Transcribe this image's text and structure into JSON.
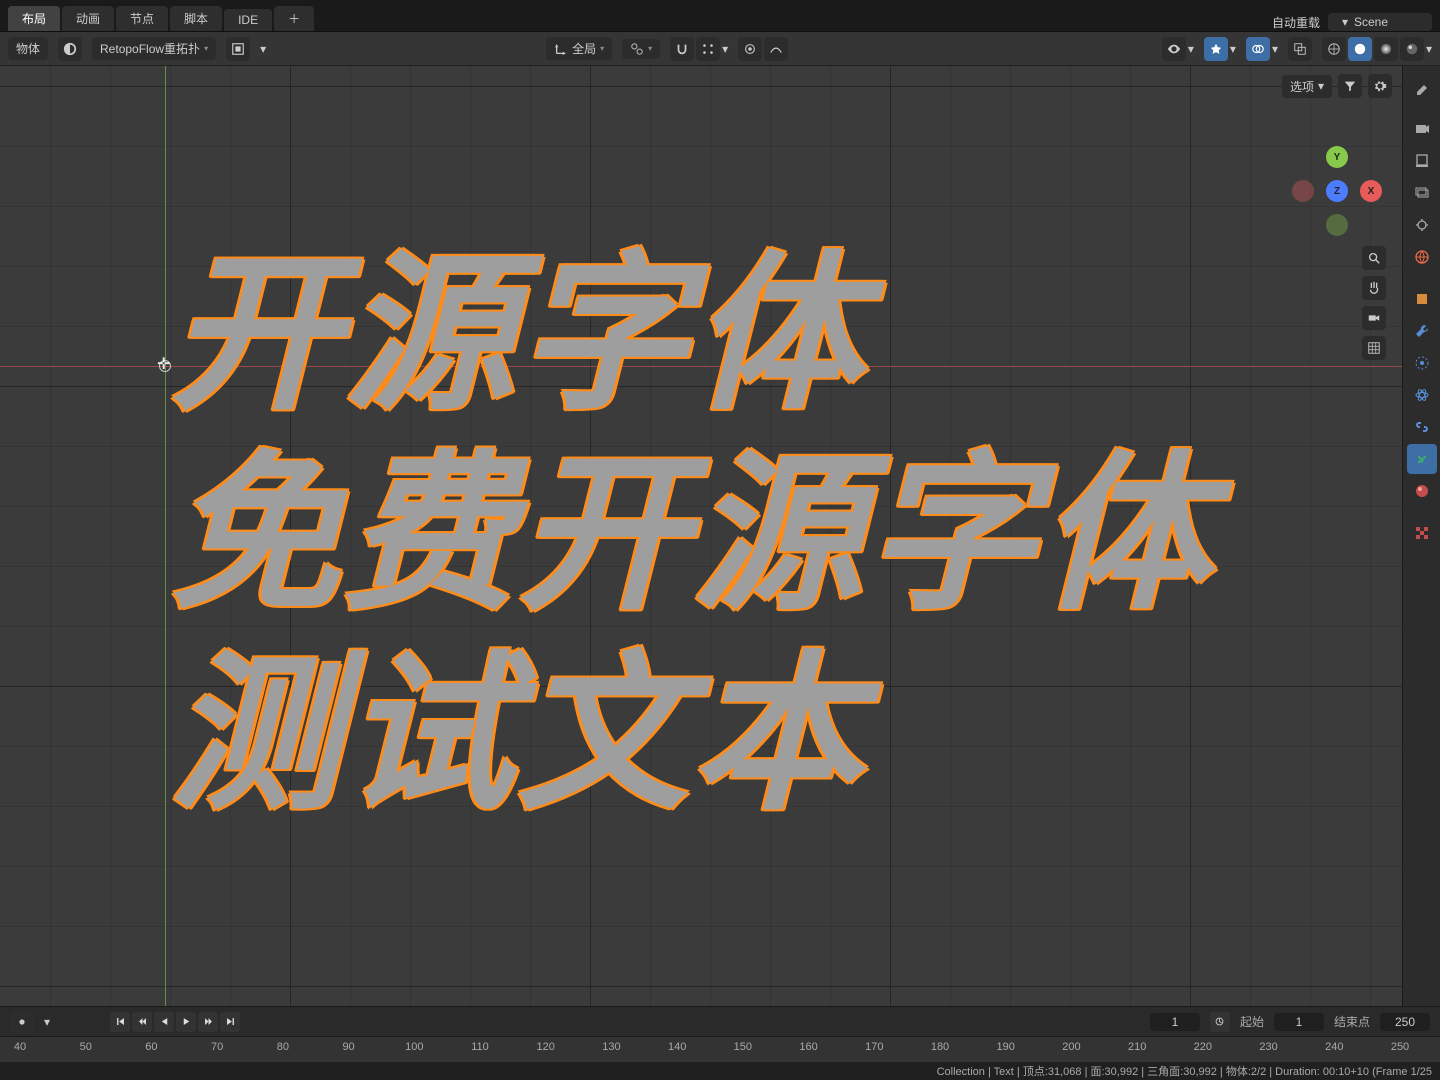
{
  "workspace_tabs": {
    "items": [
      "布局",
      "动画",
      "节点",
      "脚本",
      "IDE"
    ],
    "active_index": 0,
    "auto_reload_label": "自动重载",
    "scene_label": "Scene"
  },
  "header": {
    "mode_label": "物体",
    "retopo_label": "RetopoFlow重拓扑",
    "global_label": "全局"
  },
  "viewport": {
    "text_line1": "开源字体",
    "text_line2": "免费开源字体",
    "text_line3": "测试文本",
    "options_label": "选项",
    "gizmo": {
      "x": "X",
      "y": "Y",
      "z": "Z"
    }
  },
  "timeline": {
    "current_frame": "1",
    "start_label": "起始",
    "start_value": "1",
    "end_label": "结束点",
    "end_value": "250",
    "ruler_ticks": [
      "40",
      "50",
      "60",
      "70",
      "80",
      "90",
      "100",
      "110",
      "120",
      "130",
      "140",
      "150",
      "160",
      "170",
      "180",
      "190",
      "200",
      "210",
      "220",
      "230",
      "240",
      "250"
    ]
  },
  "status": {
    "text": "Collection | Text | 顶点:31,068 | 面:30,992 | 三角面:30,992 | 物体:2/2 | Duration: 00:10+10 (Frame 1/25"
  }
}
